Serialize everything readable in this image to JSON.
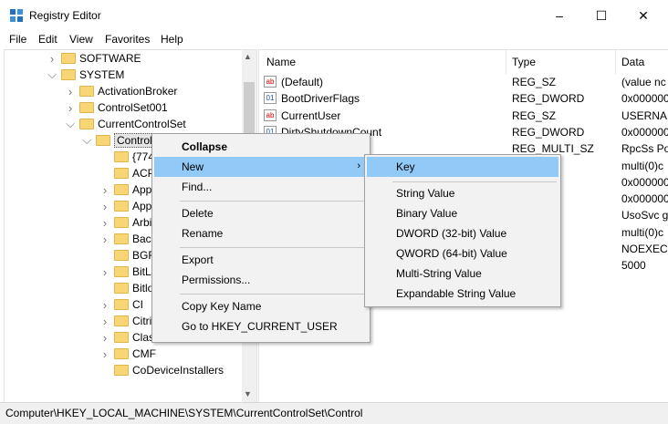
{
  "window": {
    "title": "Registry Editor",
    "minimize": "–",
    "maximize": "☐",
    "close": "✕"
  },
  "menubar": [
    "File",
    "Edit",
    "View",
    "Favorites",
    "Help"
  ],
  "tree": [
    {
      "label": "SOFTWARE",
      "level": 2,
      "chevron": ">"
    },
    {
      "label": "SYSTEM",
      "level": 2,
      "chevron": "v"
    },
    {
      "label": "ActivationBroker",
      "level": 3,
      "chevron": ">"
    },
    {
      "label": "ControlSet001",
      "level": 3,
      "chevron": ">"
    },
    {
      "label": "CurrentControlSet",
      "level": 3,
      "chevron": "v"
    },
    {
      "label": "Control",
      "level": 4,
      "chevron": "v"
    },
    {
      "label": "{7746",
      "level": 5,
      "chevron": ""
    },
    {
      "label": "ACP",
      "level": 5,
      "chevron": ""
    },
    {
      "label": "App",
      "level": 5,
      "chevron": ">"
    },
    {
      "label": "App",
      "level": 5,
      "chevron": ">"
    },
    {
      "label": "Arbi",
      "level": 5,
      "chevron": ">"
    },
    {
      "label": "Bacl",
      "level": 5,
      "chevron": ">"
    },
    {
      "label": "BGF",
      "level": 5,
      "chevron": ""
    },
    {
      "label": "BitL",
      "level": 5,
      "chevron": ">"
    },
    {
      "label": "Bitlo",
      "level": 5,
      "chevron": ""
    },
    {
      "label": "CI",
      "level": 5,
      "chevron": ">"
    },
    {
      "label": "Citri",
      "level": 5,
      "chevron": ">"
    },
    {
      "label": "Clas",
      "level": 5,
      "chevron": ">"
    },
    {
      "label": "CMF",
      "level": 5,
      "chevron": ">"
    },
    {
      "label": "CoDeviceInstallers",
      "level": 5,
      "chevron": ""
    }
  ],
  "list": {
    "headers": [
      "Name",
      "Type",
      "Data"
    ],
    "rows": [
      {
        "icon": "ab",
        "name": "(Default)",
        "type": "REG_SZ",
        "data": "(value nc"
      },
      {
        "icon": "01",
        "name": "BootDriverFlags",
        "type": "REG_DWORD",
        "data": "0x000000"
      },
      {
        "icon": "ab",
        "name": "CurrentUser",
        "type": "REG_SZ",
        "data": "USERNAN"
      },
      {
        "icon": "01",
        "name": "DirtyShutdownCount",
        "type": "REG_DWORD",
        "data": "0x000000"
      },
      {
        "icon": "",
        "name": "",
        "type": "REG_MULTI_SZ",
        "data": "RpcSs Po"
      },
      {
        "icon": "",
        "name": "",
        "type": "",
        "data": "multi(0)c"
      },
      {
        "icon": "",
        "name": "",
        "type": "ORD",
        "data": "0x000000"
      },
      {
        "icon": "",
        "name": "",
        "type": "ORD",
        "data": "0x000000"
      },
      {
        "icon": "",
        "name": "",
        "type": "TI_SZ",
        "data": "UsoSvc g"
      },
      {
        "icon": "",
        "name": "",
        "type": "",
        "data": "multi(0)c"
      },
      {
        "icon": "",
        "name": "",
        "type": "",
        "data": " NOEXEC"
      },
      {
        "icon": "",
        "name": "",
        "type": "",
        "data": "5000"
      }
    ]
  },
  "context_menu": [
    {
      "label": "Collapse",
      "bold": true
    },
    {
      "label": "New",
      "submenu": true,
      "highlight": true
    },
    {
      "label": "Find..."
    },
    {
      "sep": true
    },
    {
      "label": "Delete"
    },
    {
      "label": "Rename"
    },
    {
      "sep": true
    },
    {
      "label": "Export"
    },
    {
      "label": "Permissions..."
    },
    {
      "sep": true
    },
    {
      "label": "Copy Key Name"
    },
    {
      "label": "Go to HKEY_CURRENT_USER"
    }
  ],
  "submenu": [
    {
      "label": "Key",
      "highlight": true
    },
    {
      "sep": true
    },
    {
      "label": "String Value"
    },
    {
      "label": "Binary Value"
    },
    {
      "label": "DWORD (32-bit) Value"
    },
    {
      "label": "QWORD (64-bit) Value"
    },
    {
      "label": "Multi-String Value"
    },
    {
      "label": "Expandable String Value"
    }
  ],
  "status": "Computer\\HKEY_LOCAL_MACHINE\\SYSTEM\\CurrentControlSet\\Control",
  "colors": {
    "highlight": "#91c9f7",
    "folder": "#f8d675"
  }
}
